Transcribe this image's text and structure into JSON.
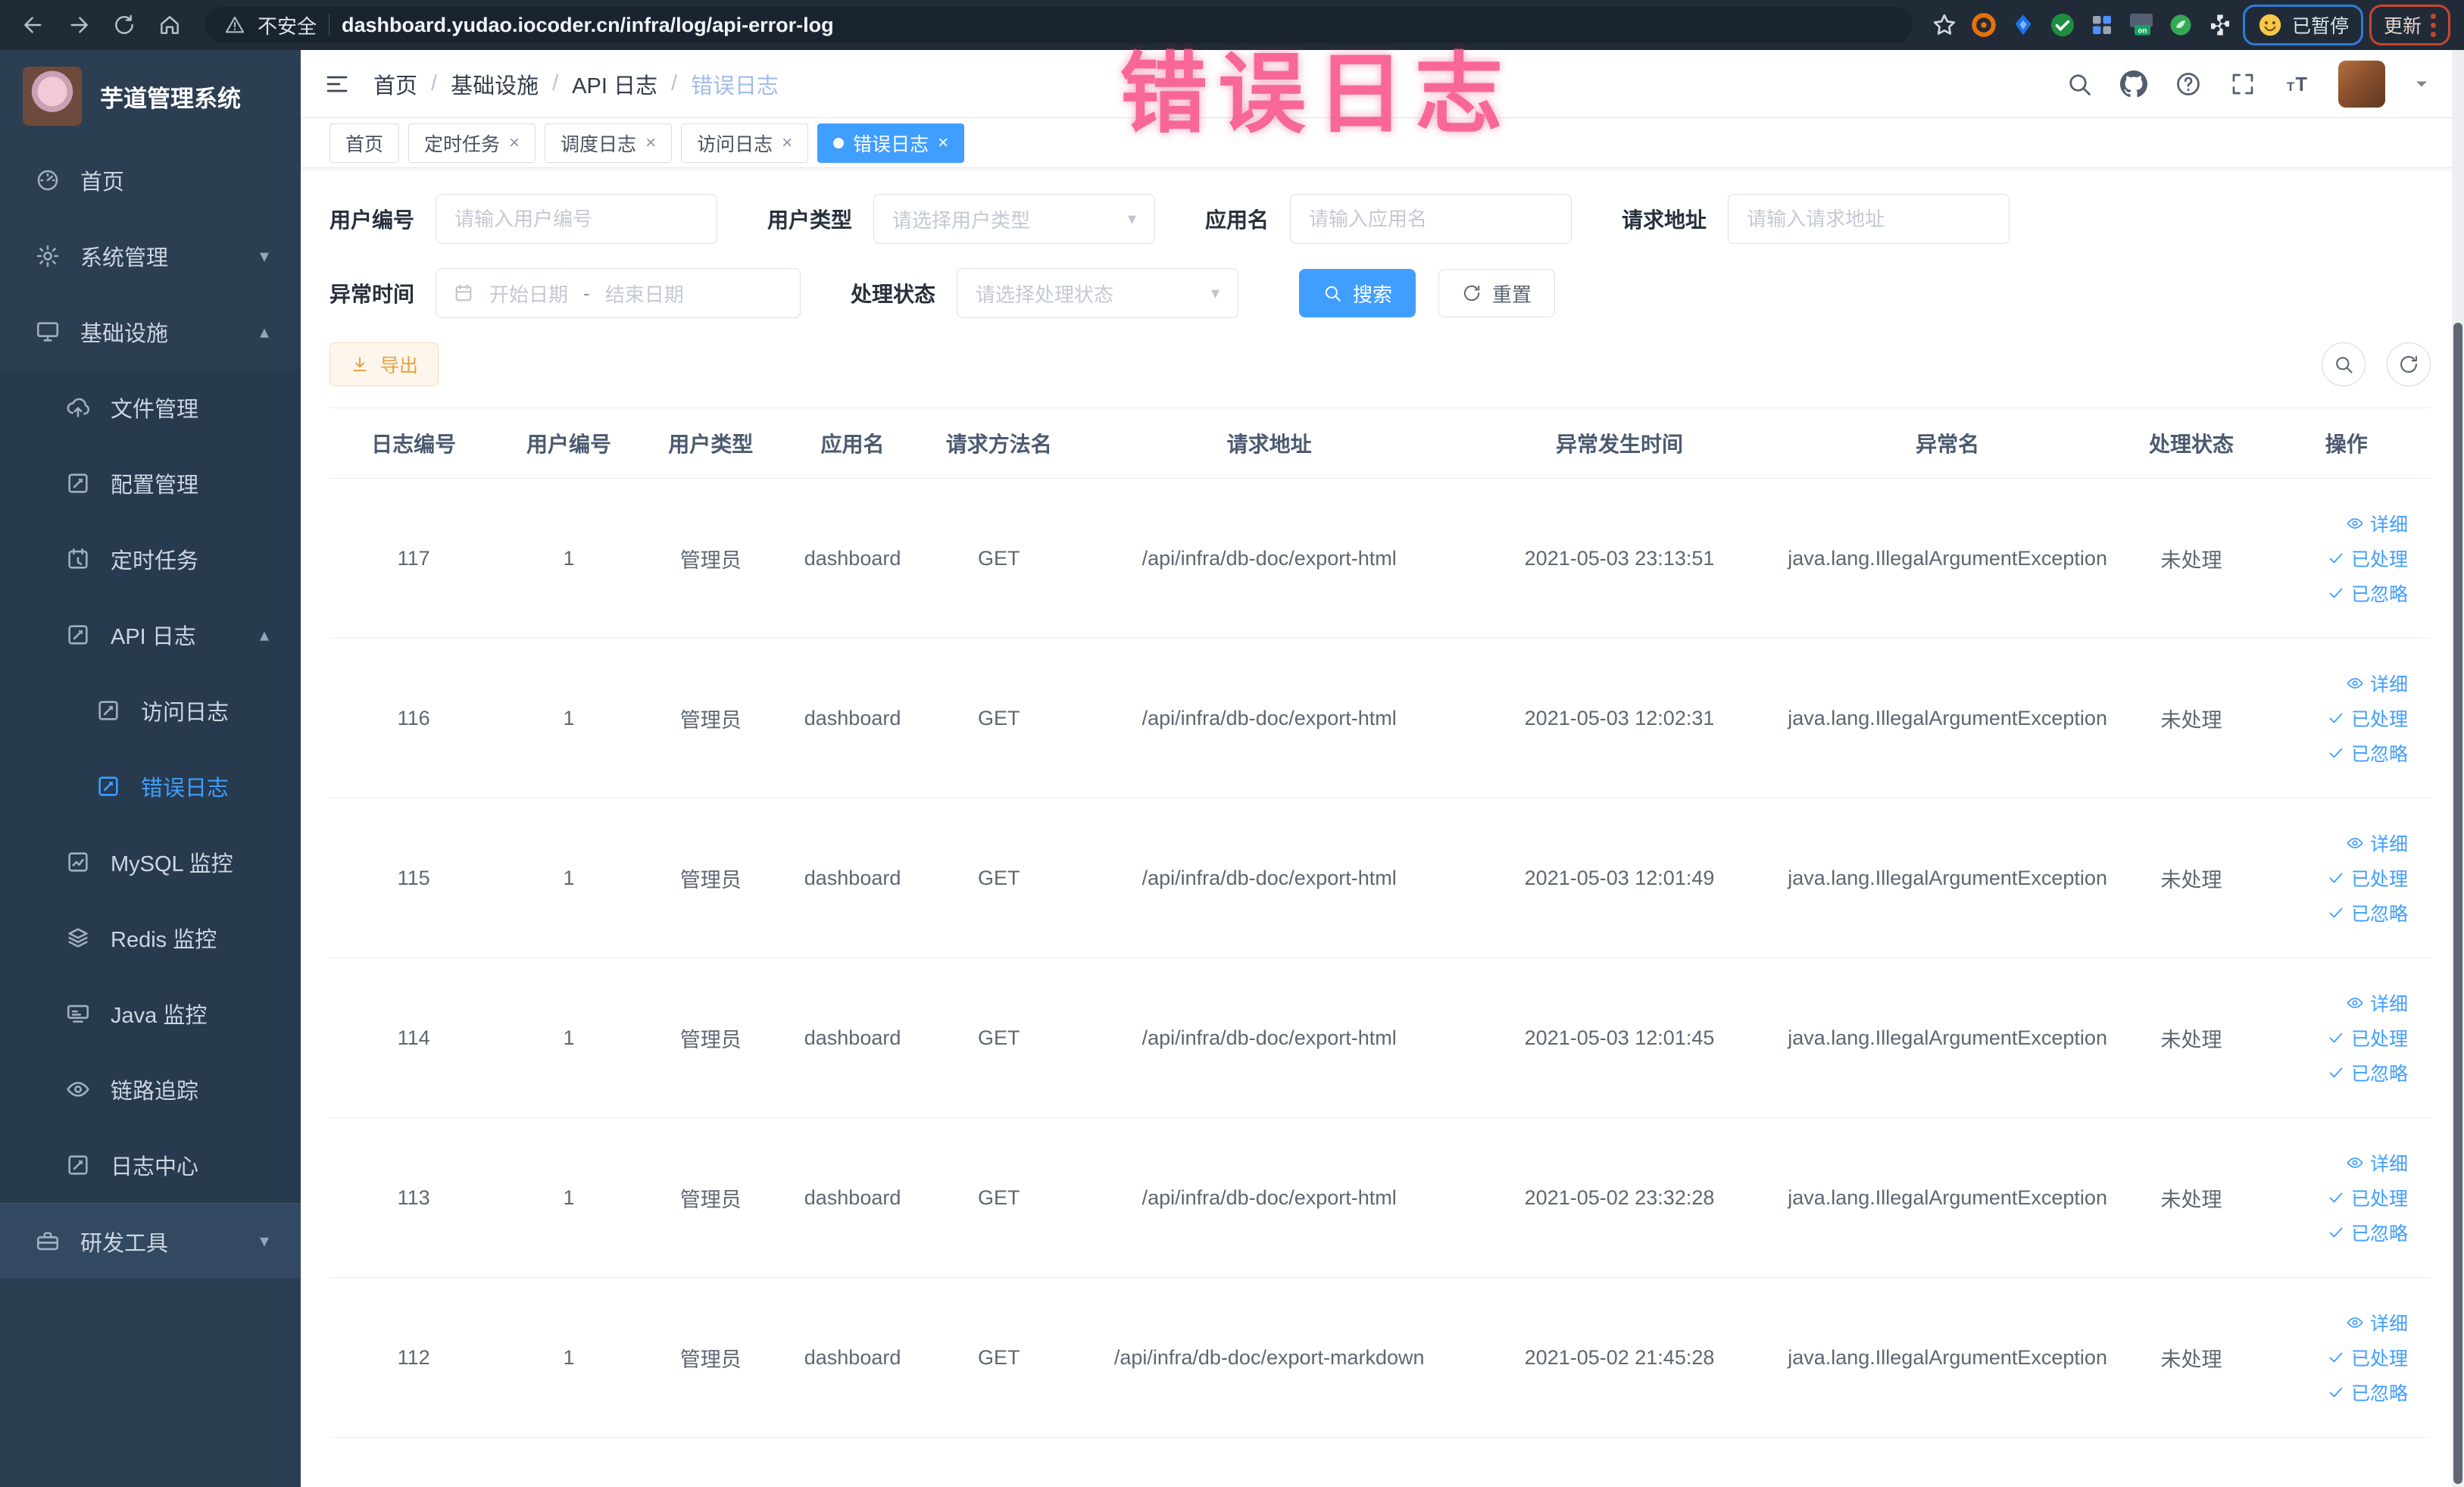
{
  "browser": {
    "security_label": "不安全",
    "url": "dashboard.yudao.iocoder.cn/infra/log/api-error-log",
    "paused_badge": "已暂停",
    "update_badge": "更新"
  },
  "sidebar": {
    "app_title": "芋道管理系统",
    "items": [
      {
        "name": "home",
        "label": "首页",
        "icon": "dashboard-icon",
        "level": 0
      },
      {
        "name": "system-management",
        "label": "系统管理",
        "icon": "gear-icon",
        "level": 0,
        "chevron": "down"
      },
      {
        "name": "infrastructure",
        "label": "基础设施",
        "icon": "monitor-icon",
        "level": 0,
        "chevron": "up"
      },
      {
        "name": "file-management",
        "label": "文件管理",
        "icon": "cloud-upload-icon",
        "level": 1
      },
      {
        "name": "config-management",
        "label": "配置管理",
        "icon": "edit-square-icon",
        "level": 1
      },
      {
        "name": "scheduled-tasks",
        "label": "定时任务",
        "icon": "timer-icon",
        "level": 1
      },
      {
        "name": "api-log",
        "label": "API 日志",
        "icon": "edit-square-icon",
        "level": 1,
        "chevron": "up"
      },
      {
        "name": "access-log",
        "label": "访问日志",
        "icon": "edit-square-icon",
        "level": 2
      },
      {
        "name": "error-log",
        "label": "错误日志",
        "icon": "edit-square-icon",
        "level": 2,
        "active": true
      },
      {
        "name": "mysql-monitor",
        "label": "MySQL 监控",
        "icon": "chart-icon",
        "level": 1
      },
      {
        "name": "redis-monitor",
        "label": "Redis 监控",
        "icon": "layers-icon",
        "level": 1
      },
      {
        "name": "java-monitor",
        "label": "Java 监控",
        "icon": "java-monitor-icon",
        "level": 1
      },
      {
        "name": "trace",
        "label": "链路追踪",
        "icon": "eye-icon",
        "level": 1
      },
      {
        "name": "log-center",
        "label": "日志中心",
        "icon": "edit-square-icon",
        "level": 1
      },
      {
        "name": "dev-tools",
        "label": "研发工具",
        "icon": "briefcase-icon",
        "level": 0,
        "chevron": "down"
      }
    ]
  },
  "header": {
    "breadcrumb": [
      "首页",
      "基础设施",
      "API 日志",
      "错误日志"
    ],
    "overlay_text": "错误日志"
  },
  "tabs": [
    {
      "name": "home",
      "label": "首页"
    },
    {
      "name": "scheduled-tasks",
      "label": "定时任务",
      "closable": true
    },
    {
      "name": "schedule-log",
      "label": "调度日志",
      "closable": true
    },
    {
      "name": "access-log",
      "label": "访问日志",
      "closable": true
    },
    {
      "name": "error-log",
      "label": "错误日志",
      "closable": true,
      "active": true
    }
  ],
  "filters": {
    "user_id": {
      "label": "用户编号",
      "placeholder": "请输入用户编号"
    },
    "user_type": {
      "label": "用户类型",
      "placeholder": "请选择用户类型"
    },
    "app_name": {
      "label": "应用名",
      "placeholder": "请输入应用名"
    },
    "request_url": {
      "label": "请求地址",
      "placeholder": "请输入请求地址"
    },
    "error_time": {
      "label": "异常时间",
      "start_placeholder": "开始日期",
      "separator": "-",
      "end_placeholder": "结束日期"
    },
    "process_status": {
      "label": "处理状态",
      "placeholder": "请选择处理状态"
    },
    "search_label": "搜索",
    "reset_label": "重置"
  },
  "toolbar": {
    "export_label": "导出"
  },
  "table": {
    "headers": [
      "日志编号",
      "用户编号",
      "用户类型",
      "应用名",
      "请求方法名",
      "请求地址",
      "异常发生时间",
      "异常名",
      "处理状态",
      "操作"
    ],
    "actions": [
      "详细",
      "已处理",
      "已忽略"
    ],
    "rows": [
      {
        "id": "117",
        "user_id": "1",
        "user_type": "管理员",
        "app": "dashboard",
        "method": "GET",
        "url": "/api/infra/db-doc/export-html",
        "time": "2021-05-03 23:13:51",
        "exception": "java.lang.IllegalArgumentException",
        "status": "未处理"
      },
      {
        "id": "116",
        "user_id": "1",
        "user_type": "管理员",
        "app": "dashboard",
        "method": "GET",
        "url": "/api/infra/db-doc/export-html",
        "time": "2021-05-03 12:02:31",
        "exception": "java.lang.IllegalArgumentException",
        "status": "未处理"
      },
      {
        "id": "115",
        "user_id": "1",
        "user_type": "管理员",
        "app": "dashboard",
        "method": "GET",
        "url": "/api/infra/db-doc/export-html",
        "time": "2021-05-03 12:01:49",
        "exception": "java.lang.IllegalArgumentException",
        "status": "未处理"
      },
      {
        "id": "114",
        "user_id": "1",
        "user_type": "管理员",
        "app": "dashboard",
        "method": "GET",
        "url": "/api/infra/db-doc/export-html",
        "time": "2021-05-03 12:01:45",
        "exception": "java.lang.IllegalArgumentException",
        "status": "未处理"
      },
      {
        "id": "113",
        "user_id": "1",
        "user_type": "管理员",
        "app": "dashboard",
        "method": "GET",
        "url": "/api/infra/db-doc/export-html",
        "time": "2021-05-02 23:32:28",
        "exception": "java.lang.IllegalArgumentException",
        "status": "未处理"
      },
      {
        "id": "112",
        "user_id": "1",
        "user_type": "管理员",
        "app": "dashboard",
        "method": "GET",
        "url": "/api/infra/db-doc/export-markdown",
        "time": "2021-05-02 21:45:28",
        "exception": "java.lang.IllegalArgumentException",
        "status": "未处理"
      }
    ]
  },
  "colors": {
    "accent": "#409eff",
    "warning": "#e6a23c",
    "overlay_pink": "#f8538a",
    "sidebar_bg": "#2c3e52"
  }
}
